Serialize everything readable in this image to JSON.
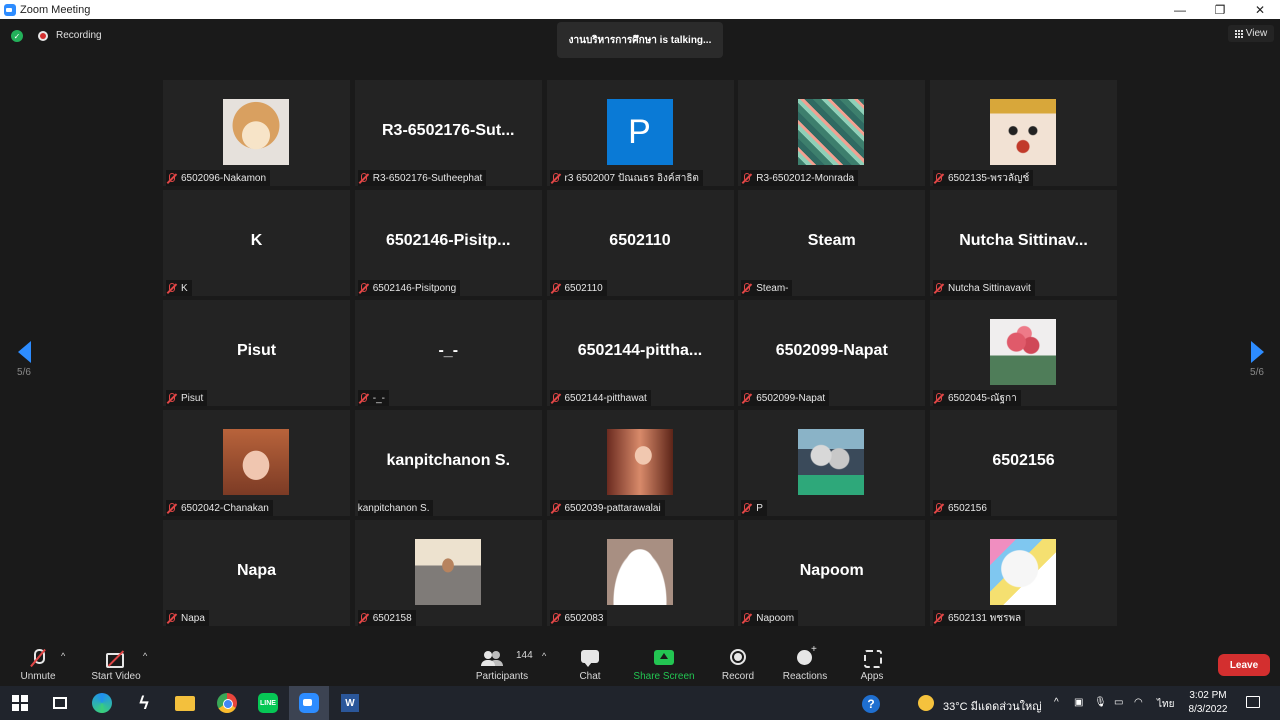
{
  "window": {
    "title": "Zoom Meeting",
    "controls": [
      "—",
      "❐",
      "✕"
    ]
  },
  "meeting": {
    "recording_label": "Recording",
    "talking_banner": "งานบริหารการศึกษา is talking...",
    "view_label": "View",
    "page_indicator_left": "5/6",
    "page_indicator_right": "5/6"
  },
  "tiles": [
    {
      "name": "6502096-Nakamon",
      "display": "",
      "picture": "dog"
    },
    {
      "name": "R3-6502176-Sutheephat",
      "display": "R3-6502176-Sut...",
      "picture": ""
    },
    {
      "name": "r3 6502007 ปัณณธร อิงค์สาธิต",
      "display": "",
      "picture": "p"
    },
    {
      "name": "R3-6502012-Monrada",
      "display": "",
      "picture": "leaves"
    },
    {
      "name": "6502135-พรวลัญช์",
      "display": "",
      "picture": "face"
    },
    {
      "name": "K",
      "display": "K",
      "picture": ""
    },
    {
      "name": "6502146-Pisitpong",
      "display": "6502146-Pisitp...",
      "picture": ""
    },
    {
      "name": "6502110",
      "display": "6502110",
      "picture": ""
    },
    {
      "name": "Steam-",
      "display": "Steam",
      "picture": ""
    },
    {
      "name": "Nutcha Sittinavavit",
      "display": "Nutcha  Sittinav...",
      "picture": ""
    },
    {
      "name": "Pisut",
      "display": "Pisut",
      "picture": ""
    },
    {
      "name": "-_-",
      "display": "-_-",
      "picture": ""
    },
    {
      "name": "6502144-pitthawat",
      "display": "6502144-pittha...",
      "picture": ""
    },
    {
      "name": "6502099-Napat",
      "display": "6502099-Napat",
      "picture": ""
    },
    {
      "name": "6502045-ณัฐกา",
      "display": "",
      "picture": "flowers"
    },
    {
      "name": "6502042-Chanakan",
      "display": "",
      "picture": "girl"
    },
    {
      "name": "kanpitchanon S.",
      "display": "kanpitchanon S.",
      "picture": ""
    },
    {
      "name": "6502039-pattarawalai",
      "display": "",
      "picture": "selfie"
    },
    {
      "name": "P",
      "display": "",
      "picture": "room"
    },
    {
      "name": "6502156",
      "display": "6502156",
      "picture": ""
    },
    {
      "name": "Napa",
      "display": "Napa",
      "picture": ""
    },
    {
      "name": "6502158",
      "display": "",
      "picture": "man"
    },
    {
      "name": "6502083",
      "display": "",
      "picture": "avatar"
    },
    {
      "name": "Napoom",
      "display": "Napoom",
      "picture": ""
    },
    {
      "name": "6502131 พชรพล",
      "display": "",
      "picture": "unicorn"
    }
  ],
  "tile_muted": [
    true,
    true,
    true,
    true,
    true,
    true,
    true,
    true,
    true,
    true,
    true,
    true,
    true,
    true,
    true,
    true,
    false,
    true,
    true,
    true,
    true,
    true,
    true,
    true,
    true
  ],
  "p_avatar_letter": "P",
  "toolbar": {
    "unmute": "Unmute",
    "start_video": "Start Video",
    "participants": "Participants",
    "participants_count": "144",
    "chat": "Chat",
    "share_screen": "Share Screen",
    "record": "Record",
    "reactions": "Reactions",
    "apps": "Apps",
    "leave": "Leave"
  },
  "taskbar": {
    "word_letter": "W",
    "line_label": "LINE",
    "help": "?",
    "weather": "33°C  มีแดดส่วนใหญ่",
    "language": "ไทย",
    "time": "3:02 PM",
    "date": "8/3/2022"
  },
  "colors": {
    "accent": "#2d8cff",
    "share_green": "#23c552",
    "leave_red": "#d32f2f",
    "muted_red": "#e04646"
  }
}
